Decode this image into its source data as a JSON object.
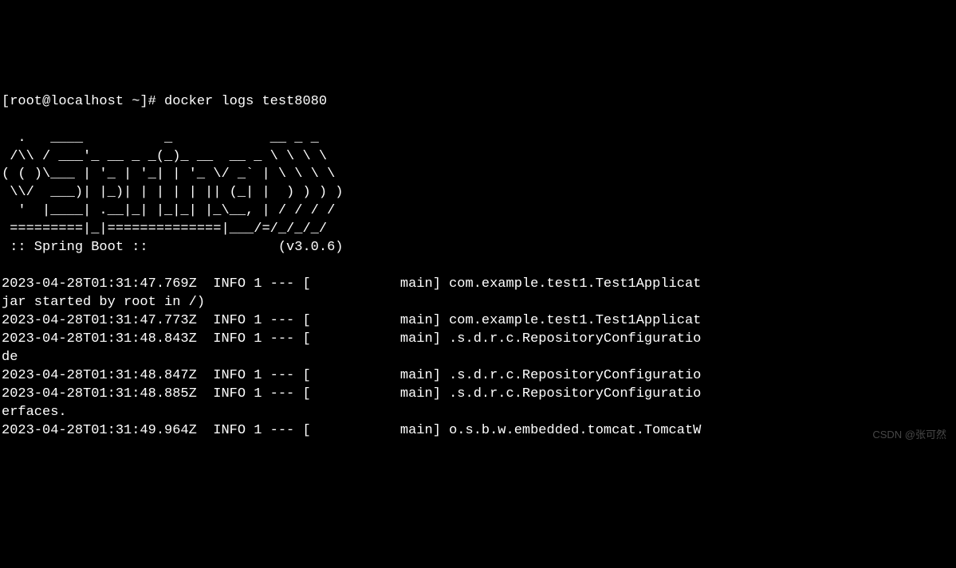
{
  "terminal": {
    "prompt": "[root@localhost ~]# ",
    "command": "docker logs test8080",
    "ascii_art": [
      "",
      "  .   ____          _            __ _ _",
      " /\\\\ / ___'_ __ _ _(_)_ __  __ _ \\ \\ \\ \\",
      "( ( )\\___ | '_ | '_| | '_ \\/ _` | \\ \\ \\ \\",
      " \\\\/  ___)| |_)| | | | | || (_| |  ) ) ) )",
      "  '  |____| .__|_| |_|_| |_\\__, | / / / /",
      " =========|_|==============|___/=/_/_/_/",
      " :: Spring Boot ::                (v3.0.6)",
      ""
    ],
    "log_lines": [
      "2023-04-28T01:31:47.769Z  INFO 1 --- [           main] com.example.test1.Test1Applicat",
      "jar started by root in /)",
      "2023-04-28T01:31:47.773Z  INFO 1 --- [           main] com.example.test1.Test1Applicat",
      "2023-04-28T01:31:48.843Z  INFO 1 --- [           main] .s.d.r.c.RepositoryConfiguratio",
      "de",
      "2023-04-28T01:31:48.847Z  INFO 1 --- [           main] .s.d.r.c.RepositoryConfiguratio",
      "2023-04-28T01:31:48.885Z  INFO 1 --- [           main] .s.d.r.c.RepositoryConfiguratio",
      "erfaces.",
      "2023-04-28T01:31:49.964Z  INFO 1 --- [           main] o.s.b.w.embedded.tomcat.TomcatW"
    ]
  },
  "watermark": "CSDN @张可然"
}
